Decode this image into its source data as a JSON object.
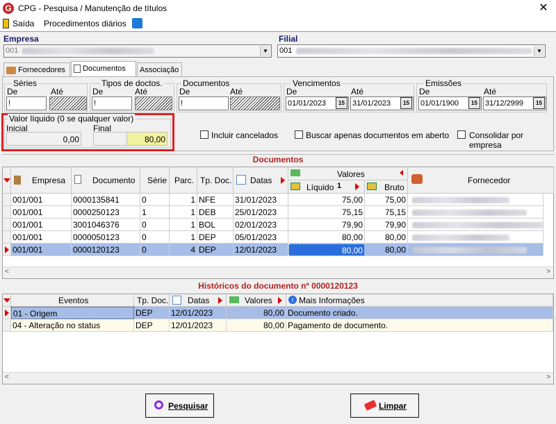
{
  "window": {
    "title": "CPG - Pesquisa / Manutenção de títulos",
    "close_glyph": "✕",
    "logo_letter": "G"
  },
  "menu": {
    "exit": "Saída",
    "daily": "Procedimentos diários"
  },
  "empresa": {
    "label": "Empresa",
    "value": "001"
  },
  "filial": {
    "label": "Filial",
    "value": "001"
  },
  "tabs": [
    "Fornecedores",
    "Documentos",
    "Associação"
  ],
  "filters": {
    "series": {
      "title": "Séries",
      "de_label": "De",
      "ate_label": "Até",
      "de": "!"
    },
    "tipos": {
      "title": "Tipos de doctos.",
      "de_label": "De",
      "ate_label": "Até",
      "de": "!"
    },
    "documentos": {
      "title": "Documentos",
      "de_label": "De",
      "ate_label": "Até",
      "de": "!"
    },
    "vencimentos": {
      "title": "Vencimentos",
      "de_label": "De",
      "ate_label": "Até",
      "de": "01/01/2023",
      "ate": "31/01/2023"
    },
    "emissoes": {
      "title": "Emissões",
      "de_label": "De",
      "ate_label": "Até",
      "de": "01/01/1900",
      "ate": "31/12/2999"
    },
    "valor": {
      "title": "Valor líquido (0 se qualquer valor)",
      "inicial_label": "Inicial",
      "final_label": "Final",
      "inicial": "0,00",
      "final": "80,00"
    },
    "incluir_cancelados": "Incluir cancelados",
    "buscar_abertos": "Buscar apenas documentos em aberto",
    "consolidar": "Consolidar por empresa",
    "date_btn": "15"
  },
  "documentos": {
    "title": "Documentos",
    "columns": {
      "empresa": "Empresa",
      "documento": "Documento",
      "serie": "Série",
      "parc": "Parc.",
      "tpdoc": "Tp. Doc.",
      "datas": "Datas",
      "valores": "Valores",
      "liquido": "Líquido",
      "liquido_sort": "1",
      "bruto": "Bruto",
      "fornecedor": "Fornecedor"
    },
    "rows": [
      {
        "empresa": "001/001",
        "documento": "0000135841",
        "serie": "0",
        "parc": "1",
        "tpdoc": "NFE",
        "data": "31/01/2023",
        "liquido": "75,00",
        "bruto": "75,00"
      },
      {
        "empresa": "001/001",
        "documento": "0000250123",
        "serie": "1",
        "parc": "1",
        "tpdoc": "DEB",
        "data": "25/01/2023",
        "liquido": "75,15",
        "bruto": "75,15"
      },
      {
        "empresa": "001/001",
        "documento": "3001046376",
        "serie": "0",
        "parc": "1",
        "tpdoc": "BOL",
        "data": "02/01/2023",
        "liquido": "79,90",
        "bruto": "79,90"
      },
      {
        "empresa": "001/001",
        "documento": "0000050123",
        "serie": "0",
        "parc": "1",
        "tpdoc": "DEP",
        "data": "05/01/2023",
        "liquido": "80,00",
        "bruto": "80,00"
      },
      {
        "empresa": "001/001",
        "documento": "0000120123",
        "serie": "0",
        "parc": "4",
        "tpdoc": "DEP",
        "data": "12/01/2023",
        "liquido": "80,00",
        "bruto": "80,00"
      }
    ]
  },
  "historicos": {
    "title": "Históricos do documento nº 0000120123",
    "columns": {
      "eventos": "Eventos",
      "tpdoc": "Tp. Doc.",
      "datas": "Datas",
      "valores": "Valores",
      "info": "Mais Informações"
    },
    "rows": [
      {
        "evento": "01 - Origem",
        "tpdoc": "DEP",
        "data": "12/01/2023",
        "valor": "80,00",
        "info": "Documento criado."
      },
      {
        "evento": "04 - Alteração no status",
        "tpdoc": "DEP",
        "data": "12/01/2023",
        "valor": "80,00",
        "info": "Pagamento de documento."
      }
    ]
  },
  "buttons": {
    "pesquisar": "Pesquisar",
    "limpar": "Limpar"
  },
  "colors": {
    "highlight": "#a6bde8",
    "selected_cell": "#2a6edc",
    "red_box": "#e02020",
    "final_field": "#f2f2a0",
    "section_title": "#b22222"
  }
}
